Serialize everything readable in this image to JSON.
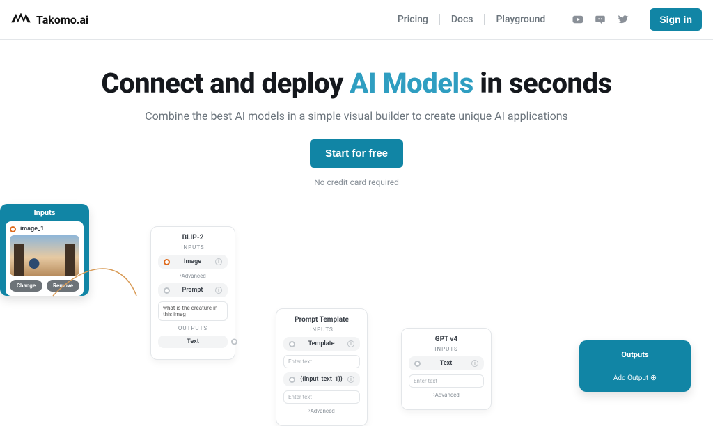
{
  "brand": {
    "name": "Takomo.ai"
  },
  "nav": {
    "links": [
      "Pricing",
      "Docs",
      "Playground"
    ],
    "signin": "Sign in"
  },
  "hero": {
    "h1_a": "Connect and deploy ",
    "h1_b": "AI Models",
    "h1_c": " in seconds",
    "sub": "Combine the best AI models in a simple visual builder to create unique AI applications",
    "cta": "Start for free",
    "nocard": "No credit card required"
  },
  "canvas": {
    "inputs": {
      "title": "Inputs",
      "image_name": "image_1",
      "btn_change": "Change",
      "btn_remove": "Remove"
    },
    "blip": {
      "title": "BLIP-2",
      "inputs_label": "INPUTS",
      "field_image": "Image",
      "advanced": "Advanced",
      "field_prompt": "Prompt",
      "prompt_value": "what is the creature in this imag",
      "outputs_label": "OUTPUTS",
      "field_text": "Text"
    },
    "ptpl": {
      "title": "Prompt Template",
      "inputs_label": "INPUTS",
      "field_template": "Template",
      "placeholder_a": "Enter text",
      "field_var": "{{input_text_1}}",
      "placeholder_b": "Enter text",
      "advanced": "Advanced"
    },
    "gpt": {
      "title": "GPT v4",
      "inputs_label": "INPUTS",
      "field_text": "Text",
      "placeholder": "Enter text",
      "advanced": "Advanced"
    },
    "outputs": {
      "title": "Outputs",
      "add": "Add Output"
    }
  }
}
